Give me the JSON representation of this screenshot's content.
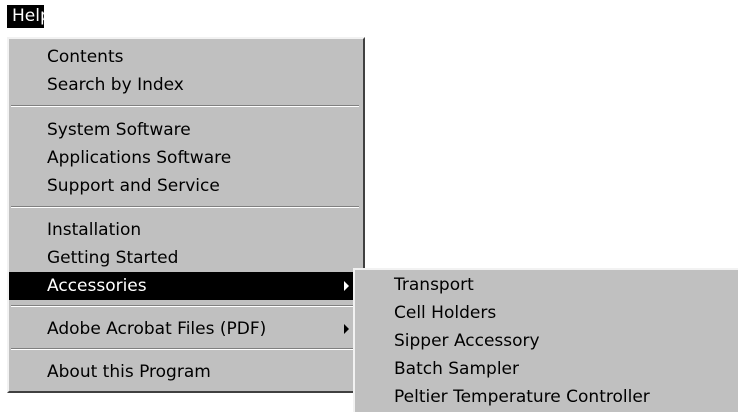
{
  "menu_title": "Help",
  "main_menu": {
    "items": [
      {
        "label": "Contents"
      },
      {
        "label": "Search by Index"
      },
      {
        "label": "System Software"
      },
      {
        "label": "Applications Software"
      },
      {
        "label": "Support and Service"
      },
      {
        "label": "Installation"
      },
      {
        "label": "Getting Started"
      },
      {
        "label": "Accessories",
        "has_submenu": true,
        "selected": true
      },
      {
        "label": "Adobe Acrobat Files (PDF)",
        "has_submenu": true
      },
      {
        "label": "About this Program"
      }
    ]
  },
  "accessories_submenu": {
    "items": [
      {
        "label": "Transport"
      },
      {
        "label": "Cell Holders"
      },
      {
        "label": "Sipper Accessory"
      },
      {
        "label": "Batch Sampler"
      },
      {
        "label": "Peltier Temperature Controller"
      }
    ]
  },
  "colors": {
    "menu_background": "#c0c0c0",
    "selection_background": "#000000",
    "selection_text": "#ffffff"
  }
}
